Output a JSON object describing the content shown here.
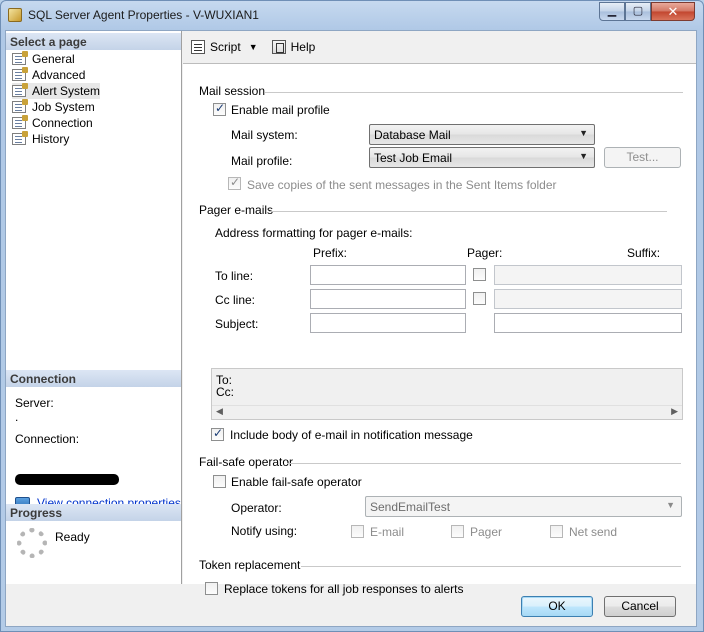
{
  "window": {
    "title": "SQL Server Agent Properties - V-WUXIAN1"
  },
  "sidebar": {
    "select_header": "Select a page",
    "pages": [
      {
        "label": "General"
      },
      {
        "label": "Advanced"
      },
      {
        "label": "Alert System",
        "selected": true
      },
      {
        "label": "Job System"
      },
      {
        "label": "Connection"
      },
      {
        "label": "History"
      }
    ],
    "connection_header": "Connection",
    "server_label": "Server:",
    "server_value": ".",
    "connection_label": "Connection:",
    "view_link": "View connection properties",
    "progress_header": "Progress",
    "progress_status": "Ready"
  },
  "toolbar": {
    "script_label": "Script",
    "help_label": "Help"
  },
  "mail_session": {
    "title": "Mail session",
    "enable_label": "Enable mail profile",
    "enable_checked": true,
    "system_label": "Mail system:",
    "system_value": "Database Mail",
    "profile_label": "Mail profile:",
    "profile_value": "Test Job Email",
    "test_button": "Test...",
    "save_copies_label": "Save copies of the sent messages in the Sent Items folder",
    "save_copies_checked": true
  },
  "pager": {
    "title": "Pager e-mails",
    "address_label": "Address formatting for pager e-mails:",
    "prefix_header": "Prefix:",
    "pager_header": "Pager:",
    "suffix_header": "Suffix:",
    "to_label": "To line:",
    "cc_label": "Cc line:",
    "subject_label": "Subject:",
    "preview_to": "To:",
    "preview_cc": "Cc:",
    "include_body_label": "Include body of e-mail in notification message",
    "include_body_checked": true
  },
  "failsafe": {
    "title": "Fail-safe operator",
    "enable_label": "Enable fail-safe operator",
    "operator_label": "Operator:",
    "operator_value": "SendEmailTest",
    "notify_label": "Notify using:",
    "email_label": "E-mail",
    "pager_label": "Pager",
    "netsend_label": "Net send"
  },
  "token": {
    "title": "Token replacement",
    "replace_label": "Replace tokens for all job responses to alerts"
  },
  "footer": {
    "ok_label": "OK",
    "cancel_label": "Cancel"
  }
}
